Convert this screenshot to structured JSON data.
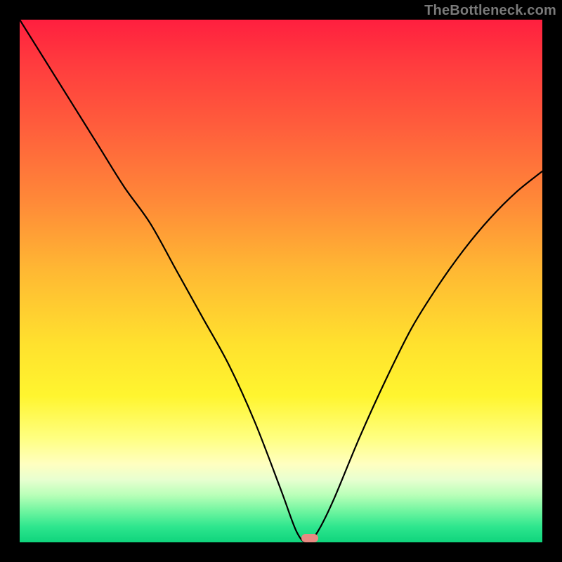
{
  "watermark": "TheBottleneck.com",
  "vertex_marker": {
    "x_pct": 55.5,
    "y_pct": 99.2,
    "color": "#e88a82"
  },
  "chart_data": {
    "type": "line",
    "title": "",
    "xlabel": "",
    "ylabel": "",
    "xlim": [
      0,
      100
    ],
    "ylim": [
      0,
      100
    ],
    "grid": false,
    "legend": "none",
    "series": [
      {
        "name": "bottleneck-curve",
        "x": [
          0,
          5,
          10,
          15,
          20,
          25,
          30,
          35,
          40,
          45,
          50,
          53,
          55,
          57,
          60,
          65,
          70,
          75,
          80,
          85,
          90,
          95,
          100
        ],
        "values": [
          100,
          92,
          84,
          76,
          68,
          61,
          52,
          43,
          34,
          23,
          10,
          2,
          0,
          2,
          8,
          20,
          31,
          41,
          49,
          56,
          62,
          67,
          71
        ]
      }
    ],
    "annotations": [
      {
        "text": "TheBottleneck.com",
        "position": "top-right"
      }
    ]
  }
}
